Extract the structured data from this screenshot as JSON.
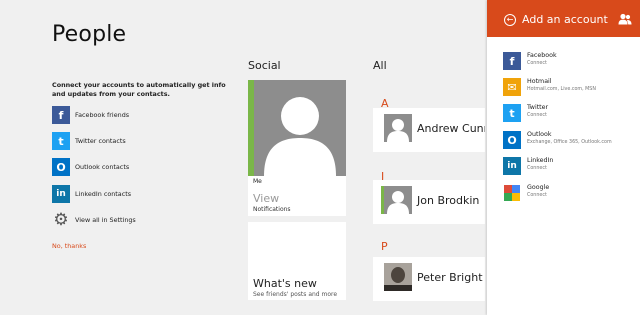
{
  "left": {
    "title": "People",
    "intro": "Connect your accounts to automatically get info and updates from your contacts.",
    "accounts": [
      {
        "label": "Facebook friends",
        "icon": "facebook-icon",
        "color": "#3b5998",
        "glyph": "f"
      },
      {
        "label": "Twitter contacts",
        "icon": "twitter-icon",
        "color": "#1da1f2",
        "glyph": "t"
      },
      {
        "label": "Outlook contacts",
        "icon": "outlook-icon",
        "color": "#0072c6",
        "glyph": "O"
      },
      {
        "label": "LinkedIn contacts",
        "icon": "linkedin-icon",
        "color": "#0e76a8",
        "glyph": "in"
      }
    ],
    "settings_label": "View all in Settings",
    "no_thanks": "No, thanks"
  },
  "social": {
    "heading": "Social",
    "me": {
      "label": "Me",
      "view": "View",
      "notifications": "Notifications"
    },
    "whats_new": {
      "title": "What's new",
      "subtitle": "See friends' posts and more"
    }
  },
  "all": {
    "heading": "All",
    "groups": [
      {
        "letter": "A",
        "contact": "Andrew Cunning"
      },
      {
        "letter": "J",
        "contact": "Jon Brodkin"
      },
      {
        "letter": "P",
        "contact": "Peter Bright"
      }
    ]
  },
  "flyout": {
    "title": "Add an account",
    "accent": "#d84a1b",
    "services": [
      {
        "name": "Facebook",
        "sub": "Connect",
        "icon": "facebook-icon",
        "color": "#3b5998",
        "glyph": "f"
      },
      {
        "name": "Hotmail",
        "sub": "Hotmail.com, Live.com, MSN",
        "icon": "mail-icon",
        "color": "#f0a30a",
        "glyph": "✉"
      },
      {
        "name": "Twitter",
        "sub": "Connect",
        "icon": "twitter-icon",
        "color": "#1da1f2",
        "glyph": "t"
      },
      {
        "name": "Outlook",
        "sub": "Exchange, Office 365, Outlook.com",
        "icon": "outlook-icon",
        "color": "#0072c6",
        "glyph": "O"
      },
      {
        "name": "LinkedIn",
        "sub": "Connect",
        "icon": "linkedin-icon",
        "color": "#0e76a8",
        "glyph": "in"
      },
      {
        "name": "Google",
        "sub": "Connect",
        "icon": "google-icon",
        "color": "#ffffff",
        "glyph": ""
      }
    ]
  }
}
